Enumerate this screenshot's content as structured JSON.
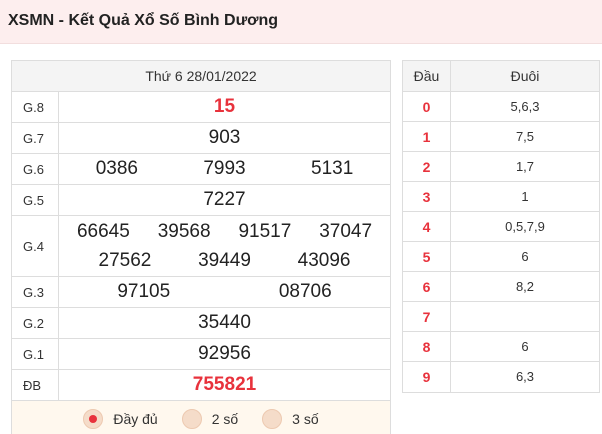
{
  "header": {
    "title": "XSMN - Kết Quả Xổ Số Bình Dương"
  },
  "results": {
    "date": "Thứ 6 28/01/2022",
    "prizes": [
      {
        "label": "G.8",
        "numbers": [
          "15"
        ]
      },
      {
        "label": "G.7",
        "numbers": [
          "903"
        ]
      },
      {
        "label": "G.6",
        "numbers": [
          "0386",
          "7993",
          "5131"
        ]
      },
      {
        "label": "G.5",
        "numbers": [
          "7227"
        ]
      },
      {
        "label": "G.4",
        "numbers": [
          "66645",
          "39568",
          "91517",
          "37047",
          "27562",
          "39449",
          "43096"
        ]
      },
      {
        "label": "G.3",
        "numbers": [
          "97105",
          "08706"
        ]
      },
      {
        "label": "G.2",
        "numbers": [
          "35440"
        ]
      },
      {
        "label": "G.1",
        "numbers": [
          "92956"
        ]
      },
      {
        "label": "ĐB",
        "numbers": [
          "755821"
        ]
      }
    ],
    "options": [
      {
        "label": "Đầy đủ",
        "selected": true
      },
      {
        "label": "2 số",
        "selected": false
      },
      {
        "label": "3 số",
        "selected": false
      }
    ]
  },
  "loto": {
    "head_col1": "Đầu",
    "head_col2": "Đuôi",
    "rows": [
      {
        "dau": "0",
        "duoi": "5,6,3"
      },
      {
        "dau": "1",
        "duoi": "7,5"
      },
      {
        "dau": "2",
        "duoi": "1,7"
      },
      {
        "dau": "3",
        "duoi": "1"
      },
      {
        "dau": "4",
        "duoi": "0,5,7,9"
      },
      {
        "dau": "5",
        "duoi": "6"
      },
      {
        "dau": "6",
        "duoi": "8,2"
      },
      {
        "dau": "7",
        "duoi": ""
      },
      {
        "dau": "8",
        "duoi": "6"
      },
      {
        "dau": "9",
        "duoi": "6,3"
      }
    ]
  },
  "colors": {
    "accent": "#e8323c",
    "header_bg": "#fdeeee",
    "options_bg": "#fff8ee"
  }
}
